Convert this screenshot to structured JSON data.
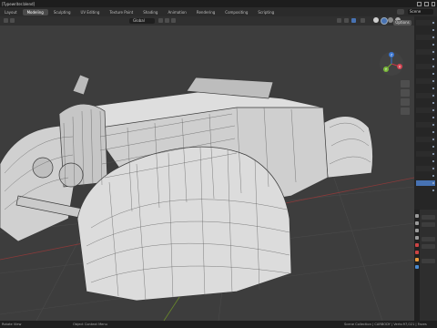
{
  "window": {
    "title": "[Typewriter.blend]"
  },
  "workspace_tabs": [
    {
      "label": "Layout",
      "active": false
    },
    {
      "label": "Modeling",
      "active": true
    },
    {
      "label": "Sculpting",
      "active": false
    },
    {
      "label": "UV Editing",
      "active": false
    },
    {
      "label": "Texture Paint",
      "active": false
    },
    {
      "label": "Shading",
      "active": false
    },
    {
      "label": "Animation",
      "active": false
    },
    {
      "label": "Rendering",
      "active": false
    },
    {
      "label": "Compositing",
      "active": false
    },
    {
      "label": "Scripting",
      "active": false
    }
  ],
  "scene": {
    "label": "Scene"
  },
  "viewport_header": {
    "orientation": "Global",
    "options_label": "Options"
  },
  "gizmo": {
    "x": "X",
    "y": "Y",
    "z": "Z"
  },
  "status_bar": {
    "left": "Rotate View",
    "middle": "Object Context Menu",
    "right": "Scene Collection | CARBODY | Verts:97,021 | Faces"
  },
  "colors": {
    "accent": "#4772b3",
    "active_tab": "#4a4a4a",
    "grid_red": "#8a3a3a",
    "grid_green": "#6a8a2a",
    "model_fill": "#d7d7d7",
    "wire": "#3a3a3a"
  }
}
